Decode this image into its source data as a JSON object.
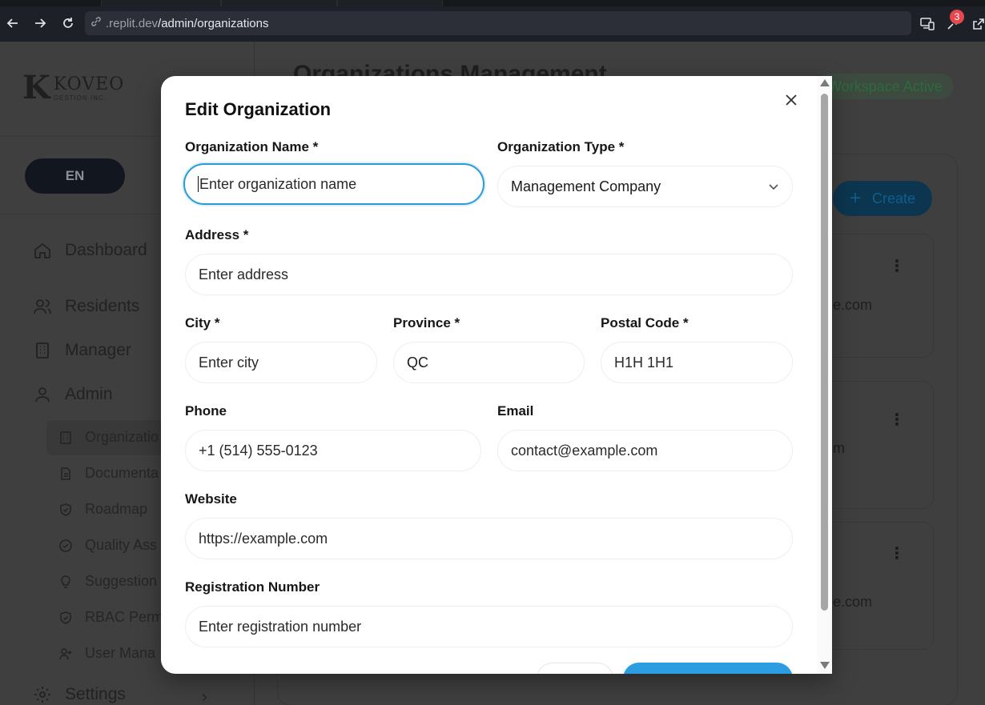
{
  "browser": {
    "url_host": ".replit.dev",
    "url_path": "/admin/organizations",
    "notification_count": "3"
  },
  "sidebar": {
    "logo_mark": "K",
    "logo_name": "KOVEO",
    "logo_sub": "GESTION INC.",
    "language": "EN",
    "items": [
      {
        "label": "Dashboard",
        "icon": "home-icon"
      },
      {
        "label": "Residents",
        "icon": "users-icon"
      },
      {
        "label": "Manager",
        "icon": "building-icon"
      },
      {
        "label": "Admin",
        "icon": "user-icon"
      }
    ],
    "admin_sub": [
      {
        "label": "Organizatio",
        "icon": "building-icon"
      },
      {
        "label": "Documenta",
        "icon": "document-icon"
      },
      {
        "label": "Roadmap",
        "icon": "shield-icon"
      },
      {
        "label": "Quality Ass",
        "icon": "check-circle-icon"
      },
      {
        "label": "Suggestion",
        "icon": "lightbulb-icon"
      },
      {
        "label": "RBAC Perm",
        "icon": "shield-icon"
      },
      {
        "label": "User Mana",
        "icon": "user-plus-icon"
      }
    ],
    "settings": {
      "label": "Settings",
      "icon": "gear-icon"
    }
  },
  "main": {
    "title": "Organizations Management",
    "workspace_badge": "Workspace Active",
    "create_label": "Create",
    "card_fragments": [
      "e.com",
      "m",
      "e.com"
    ]
  },
  "modal": {
    "title": "Edit Organization",
    "name": {
      "label": "Organization Name *",
      "placeholder": "Enter organization name"
    },
    "type": {
      "label": "Organization Type *",
      "value": "Management Company"
    },
    "address": {
      "label": "Address *",
      "placeholder": "Enter address"
    },
    "city": {
      "label": "City *",
      "placeholder": "Enter city"
    },
    "province": {
      "label": "Province *",
      "value": "QC"
    },
    "postal": {
      "label": "Postal Code *",
      "placeholder": "H1H 1H1"
    },
    "phone": {
      "label": "Phone",
      "placeholder": "+1 (514) 555-0123"
    },
    "email": {
      "label": "Email",
      "placeholder": "contact@example.com"
    },
    "website": {
      "label": "Website",
      "placeholder": "https://example.com"
    },
    "registration": {
      "label": "Registration Number",
      "placeholder": "Enter registration number"
    }
  },
  "colors": {
    "accent": "#2a9bd8",
    "overlay": "#3f3f40"
  }
}
